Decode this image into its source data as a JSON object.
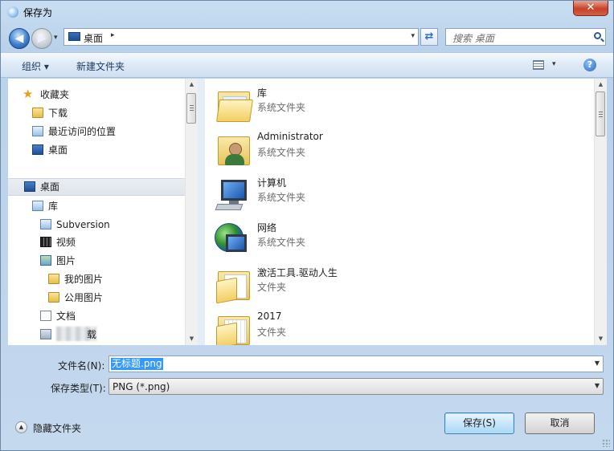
{
  "window": {
    "title": "保存为",
    "close_glyph": "✕"
  },
  "nav": {
    "back_glyph": "◀",
    "forward_glyph": "▶",
    "history_glyph": "▾",
    "address": {
      "location": "桌面",
      "chevron": "▸",
      "dropdown": "▾"
    },
    "refresh_glyph": "⇄",
    "search_placeholder": "搜索 桌面"
  },
  "toolbar": {
    "organize": "组织 ▾",
    "new_folder": "新建文件夹",
    "view_drop": "▾",
    "help_glyph": "?"
  },
  "left_tree": [
    {
      "name": "tree-favorites",
      "label": "收藏夹",
      "icon": "star-icon"
    },
    {
      "name": "tree-downloads",
      "label": "下载",
      "icon": "folder-download-icon"
    },
    {
      "name": "tree-recent",
      "label": "最近访问的位置",
      "icon": "recent-places-icon"
    },
    {
      "name": "tree-desktop-fav",
      "label": "桌面",
      "icon": "desktop-icon"
    },
    {
      "name": "tree-desktop",
      "label": "桌面",
      "icon": "desktop-icon"
    },
    {
      "name": "tree-libraries",
      "label": "库",
      "icon": "library-icon"
    },
    {
      "name": "tree-subversion",
      "label": "Subversion",
      "icon": "library-icon"
    },
    {
      "name": "tree-videos",
      "label": "视频",
      "icon": "video-icon"
    },
    {
      "name": "tree-pictures",
      "label": "图片",
      "icon": "pictures-icon"
    },
    {
      "name": "tree-my-pictures",
      "label": "我的图片",
      "icon": "folder-icon"
    },
    {
      "name": "tree-public-pictures",
      "label": "公用图片",
      "icon": "folder-icon"
    },
    {
      "name": "tree-documents",
      "label": "文档",
      "icon": "document-icon"
    },
    {
      "name": "tree-blurred",
      "label": "载",
      "icon": "drive-icon"
    }
  ],
  "files": [
    {
      "name": "库",
      "type": "系统文件夹",
      "icon": "library-folder-icon"
    },
    {
      "name": "Administrator",
      "type": "系统文件夹",
      "icon": "user-folder-icon"
    },
    {
      "name": "计算机",
      "type": "系统文件夹",
      "icon": "computer-icon"
    },
    {
      "name": "网络",
      "type": "系统文件夹",
      "icon": "network-icon"
    },
    {
      "name": "激活工具.驱动人生",
      "type": "文件夹",
      "icon": "folder-icon"
    },
    {
      "name": "2017",
      "type": "文件夹",
      "icon": "folder-icon"
    }
  ],
  "form": {
    "filename_label": "文件名(N):",
    "filename_value": "无标题.png",
    "filetype_label": "保存类型(T):",
    "filetype_value": "PNG (*.png)"
  },
  "footer": {
    "hide_folders": "隐藏文件夹",
    "save": "保存(S)",
    "cancel": "取消"
  },
  "scroll_arrows": {
    "up": "▲",
    "down": "▼"
  }
}
